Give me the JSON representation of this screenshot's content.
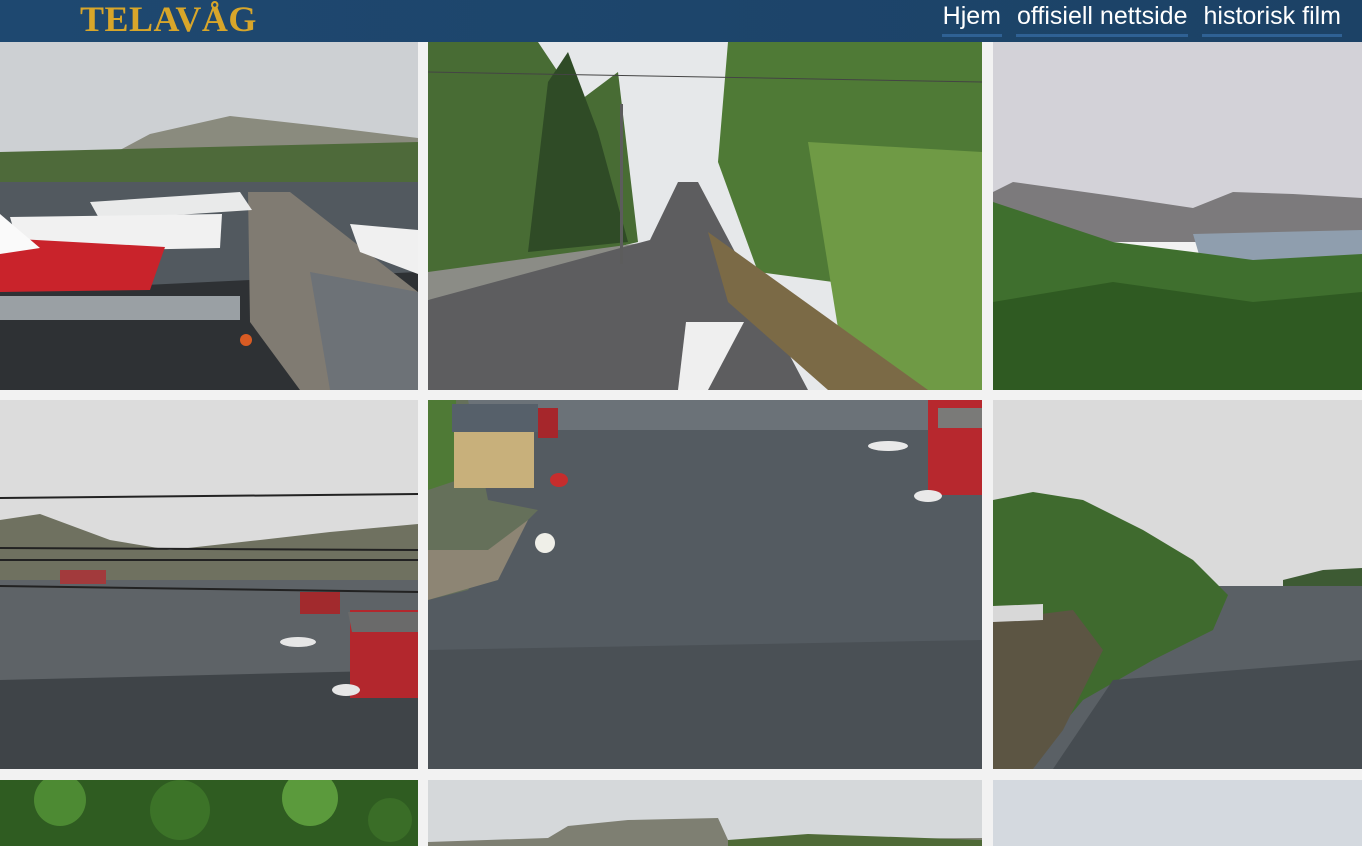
{
  "header": {
    "logo": "TELAVÅG",
    "nav": [
      {
        "label": "Hjem"
      },
      {
        "label": "offisiell nettside"
      },
      {
        "label": "historisk film"
      }
    ]
  },
  "gallery": {
    "photos": [
      {
        "subject": "harbor-boats-pier"
      },
      {
        "subject": "country-road"
      },
      {
        "subject": "lake-forest-hills"
      },
      {
        "subject": "fjord-boathouses"
      },
      {
        "subject": "inlet-red-boathouses"
      },
      {
        "subject": "rocky-headland-water"
      },
      {
        "subject": "green-foliage"
      },
      {
        "subject": "village-hill"
      },
      {
        "subject": "overcast-sky"
      }
    ]
  }
}
